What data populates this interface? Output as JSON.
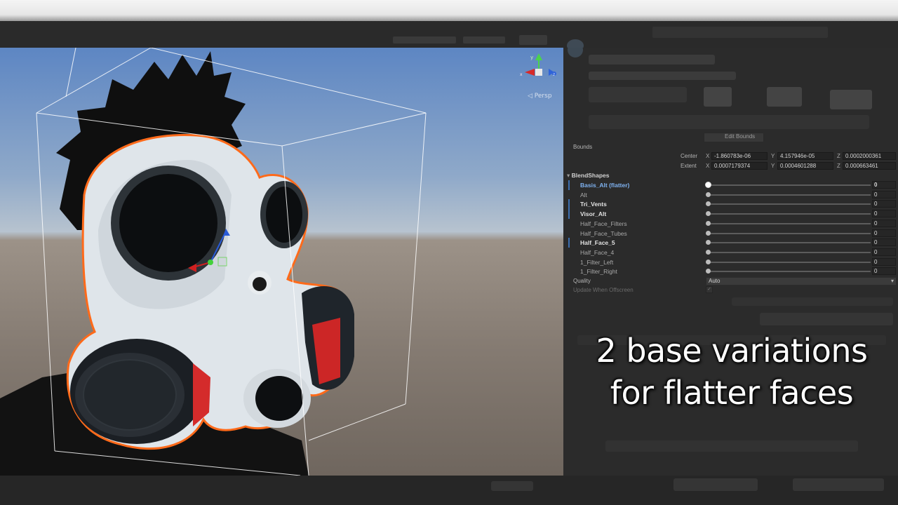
{
  "scene": {
    "camera_label": "◁ Persp",
    "icons": {
      "gizmo": "scene-orientation-gizmo-icon",
      "pivot": "move-tool-pivot-icon"
    }
  },
  "inspector": {
    "edit_bounds_label": "Edit Bounds",
    "bounds": {
      "label": "Bounds",
      "center": {
        "label": "Center",
        "x": "-1.860783e-06",
        "y": "4.157946e-05",
        "z": "0.0002000361"
      },
      "extent": {
        "label": "Extent",
        "x": "0.0007179374",
        "y": "0.0004601288",
        "z": "0.000663461"
      },
      "axis_x": "X",
      "axis_y": "Y",
      "axis_z": "Z"
    },
    "blendshapes": {
      "header": "BlendShapes",
      "items": [
        {
          "name": "Basis_Alt (flatter)",
          "value": "0"
        },
        {
          "name": "Alt",
          "value": "0"
        },
        {
          "name": "Tri_Vents",
          "value": "0"
        },
        {
          "name": "Visor_Alt",
          "value": "0"
        },
        {
          "name": "Half_Face_Filters",
          "value": "0"
        },
        {
          "name": "Half_Face_Tubes",
          "value": "0"
        },
        {
          "name": "Half_Face_5",
          "value": "0"
        },
        {
          "name": "Half_Face_4",
          "value": "0"
        },
        {
          "name": "1_Filter_Left",
          "value": "0"
        },
        {
          "name": "1_Filter_Right",
          "value": "0"
        }
      ]
    },
    "quality": {
      "label": "Quality",
      "value": "Auto"
    },
    "update_offscreen": {
      "label": "Update When Offscreen",
      "checked": true
    }
  },
  "caption": {
    "line1": "2 base variations",
    "line2": "for flatter faces"
  },
  "colors": {
    "selection_outline": "#ff6a1a",
    "accent_blue": "#7fb2f0",
    "panel_bg": "#2b2b2b"
  }
}
